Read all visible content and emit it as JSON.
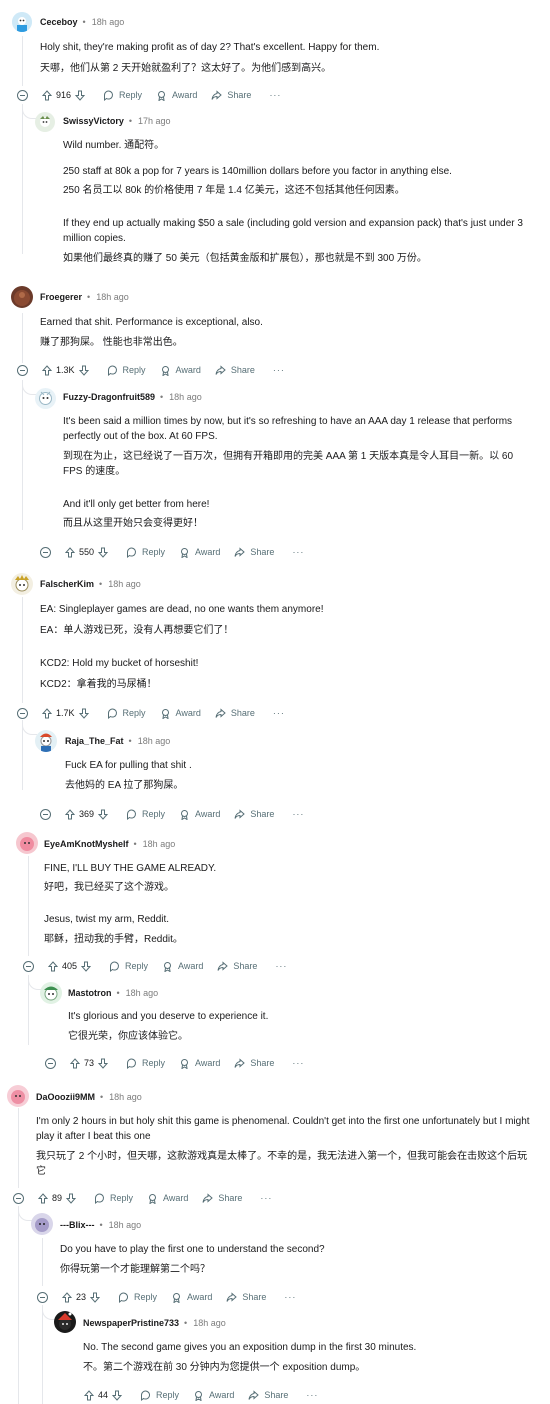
{
  "ui": {
    "reply": "Reply",
    "award": "Award",
    "share": "Share",
    "more": "···"
  },
  "comments": {
    "c1": {
      "user": "Ceceboy",
      "time": "18h ago",
      "en": "Holy shit, they're making profit as of day 2? That's excellent. Happy for them.",
      "zh": "天哪，他们从第 2 天开始就盈利了？这太好了。为他们感到高兴。",
      "votes": "916"
    },
    "c2": {
      "user": "SwissyVictory",
      "time": "17h ago",
      "l1": "Wild number.   通配符。",
      "l2": "250 staff at 80k a pop for 7 years is 140million dollars before you factor in anything else.",
      "l3": "250 名员工以 80k 的价格使用 7 年是 1.4 亿美元，这还不包括其他任何因素。",
      "l4": "If they end up actually making $50 a sale (including gold version and expansion pack) that's just under 3 million copies.",
      "l5": "如果他们最终真的赚了 50 美元（包括黄金版和扩展包），那也就是不到 300 万份。"
    },
    "c3": {
      "user": "Froegerer",
      "time": "18h ago",
      "en": "Earned that shit. Performance is exceptional, also.",
      "zh": "赚了那狗屎。 性能也非常出色。",
      "votes": "1.3K"
    },
    "c4": {
      "user": "Fuzzy-Dragonfruit589",
      "time": "18h ago",
      "l1": "It's been said a million times by now, but it's so refreshing to have an AAA day 1 release that performs perfectly out of the box. At 60 FPS.",
      "l2": "到现在为止，这已经说了一百万次，但拥有开箱即用的完美 AAA 第 1 天版本真是令人耳目一新。以 60 FPS 的速度。",
      "l3": "And it'll only get better from here!",
      "l4": "而且从这里开始只会变得更好！",
      "votes": "550"
    },
    "c5": {
      "user": "FalscherKim",
      "time": "18h ago",
      "l1": "EA: Singleplayer games are dead, no one wants them anymore!",
      "l2": "EA：单人游戏已死，没有人再想要它们了！",
      "l3": "KCD2: Hold my bucket of horseshit!",
      "l4": "KCD2：拿着我的马尿桶！",
      "votes": "1.7K"
    },
    "c6": {
      "user": "Raja_The_Fat",
      "time": "18h ago",
      "en": "Fuck EA for pulling that shit .",
      "zh": "去他妈的 EA 拉了那狗屎。",
      "votes": "369"
    },
    "c7": {
      "user": "EyeAmKnotMyshelf",
      "time": "18h ago",
      "l1": "FINE, I'LL BUY THE GAME ALREADY.",
      "l2": "好吧，我已经买了这个游戏。",
      "l3": "Jesus, twist my arm, Reddit.",
      "l4": "耶稣，扭动我的手臂，Reddit。",
      "votes": "405"
    },
    "c8": {
      "user": "Mastotron",
      "time": "18h ago",
      "en": "It's glorious and you deserve to experience it.",
      "zh": "它很光荣，你应该体验它。",
      "votes": "73"
    },
    "c9": {
      "user": "DaOoozii9MM",
      "time": "18h ago",
      "en": "I'm only 2 hours in but holy shit this game is phenomenal. Couldn't get into the first one unfortunately but I might play it after I beat this one",
      "zh": "我只玩了 2 个小时，但天哪，这款游戏真是太棒了。不幸的是，我无法进入第一个，但我可能会在击败这个后玩它",
      "votes": "89"
    },
    "c10": {
      "user": "---Blix---",
      "time": "18h ago",
      "en": "Do you have to play the first one to understand the second?",
      "zh": "你得玩第一个才能理解第二个吗？",
      "votes": "23"
    },
    "c11": {
      "user": "NewspaperPristine733",
      "time": "18h ago",
      "en": "No. The second game gives you an exposition dump in the first 30 minutes.",
      "zh": "不。第二个游戏在前 30 分钟内为您提供一个 exposition dump。",
      "votes": "44"
    }
  },
  "colors": {
    "meta": "#7c7c7c",
    "action": "#576f76",
    "text": "#1a1a1b",
    "thread": "#e5e7eb"
  }
}
